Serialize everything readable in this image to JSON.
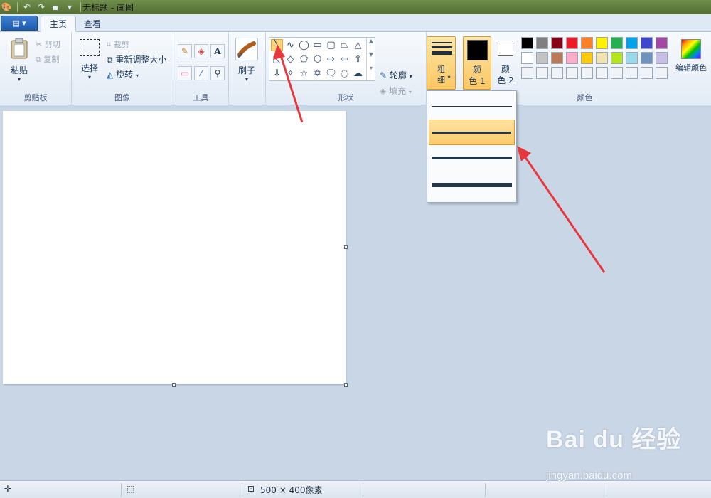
{
  "app": {
    "title": "无标题 - 画图"
  },
  "tabs": {
    "file_icon": "▤ ▾",
    "home": "主页",
    "view": "查看"
  },
  "clipboard": {
    "paste": "粘贴",
    "cut": "剪切",
    "copy": "复制",
    "label": "剪贴板"
  },
  "image": {
    "select": "选择",
    "crop": "裁剪",
    "resize": "重新调整大小",
    "rotate": "旋转",
    "label": "图像"
  },
  "tools": {
    "label": "工具",
    "text_tool": "A"
  },
  "brushes": {
    "label": "刷子"
  },
  "shapes": {
    "outline": "轮廓",
    "fill": "填充",
    "label": "形状"
  },
  "size": {
    "label_1": "粗",
    "label_2": "细"
  },
  "colors": {
    "color1_a": "颜",
    "color1_b": "色 1",
    "color2_a": "颜",
    "color2_b": "色 2",
    "edit": "编辑颜色",
    "label": "颜色",
    "color1_value": "#000000",
    "color2_value": "#ffffff",
    "palette_row1": [
      "#000000",
      "#7f7f7f",
      "#880015",
      "#ed1c24",
      "#ff7f27",
      "#fff200",
      "#22b14c",
      "#00a2e8",
      "#3f48cc",
      "#a349a4"
    ],
    "palette_row2": [
      "#ffffff",
      "#c3c3c3",
      "#b97a57",
      "#ffaec9",
      "#ffc90e",
      "#efe4b0",
      "#b5e61d",
      "#99d9ea",
      "#7092be",
      "#c8bfe7"
    ],
    "palette_row3": [
      "#f0f4f9",
      "#f0f4f9",
      "#f0f4f9",
      "#f0f4f9",
      "#f0f4f9",
      "#f0f4f9",
      "#f0f4f9",
      "#f0f4f9",
      "#f0f4f9",
      "#f0f4f9"
    ]
  },
  "size_dropdown": {
    "options": [
      "1px",
      "3px",
      "5px",
      "8px"
    ],
    "selected_index": 1
  },
  "status": {
    "canvas_size": "500 × 400像素"
  },
  "watermark": {
    "main": "Bai du 经验",
    "sub": "jingyan.baidu.com"
  },
  "annotation": {
    "arrow_color": "#e8373c"
  }
}
